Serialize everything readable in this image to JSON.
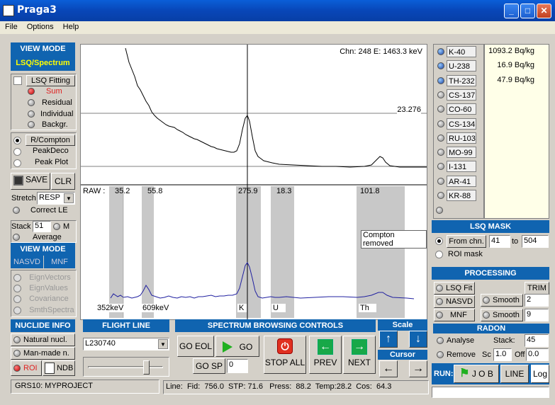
{
  "window": {
    "title": "Praga3"
  },
  "menu": [
    "File",
    "Options",
    "Help"
  ],
  "view_mode": {
    "header": "VIEW MODE",
    "mode": "LSQ/Spectrum",
    "lsq_fitting": "LSQ Fitting",
    "sum": "Sum",
    "residual": "Residual",
    "individual": "Individual",
    "backgr": "Backgr.",
    "r_compton": "R/Compton",
    "peakdeco": "PeakDeco",
    "peak_plot": "Peak Plot",
    "save": "SAVE",
    "clr": "CLR",
    "stretch_label": "Stretch",
    "stretch_value": "RESP",
    "correct_le": "Correct LE",
    "stack_label": "Stack",
    "stack_value": "51",
    "m_label": "M",
    "average": "Average"
  },
  "view_mode2": {
    "header": "VIEW MODE",
    "nasvd": "NASVD",
    "mnf": "MNF",
    "items": [
      "EignVectors",
      "EignValues",
      "Covariance",
      "SmthSpectra"
    ]
  },
  "nuclide_info": {
    "header": "NUCLIDE INFO",
    "natural": "Natural nucl.",
    "manmade": "Man-made n.",
    "roi": "ROI",
    "ndb": "NDB"
  },
  "status_left": "GRS10: MYPROJECT",
  "flight_line": {
    "header": "FLIGHT LINE",
    "value": "L230740"
  },
  "browse": {
    "header": "SPECTRUM BROWSING CONTROLS",
    "go_eol": "GO EOL",
    "go": "GO",
    "go_sp": "GO SP",
    "go_sp_value": "0",
    "stop_all": "STOP ALL",
    "prev": "PREV",
    "next": "NEXT"
  },
  "scale": {
    "header": "Scale",
    "cursor": "Cursor"
  },
  "line_status": "Line:  Fid:  756.0  STP: 71.6   Press:  88.2  Temp:28.2  Cos:  64.3",
  "spectrum": {
    "cursor_readout": "Chn: 248  E: 1463.3 keV",
    "level_label": "23.276",
    "raw_label": "RAW :",
    "roi_values": [
      "35.2",
      "55.8",
      "275.9",
      "18.3",
      "101.8"
    ],
    "compton_note": "Compton removed",
    "markers": [
      "352keV",
      "609keV",
      "K",
      "U",
      "Th"
    ]
  },
  "nuclides": [
    {
      "name": "K-40",
      "value": "1093.2 Bq/kg",
      "active": true
    },
    {
      "name": "U-238",
      "value": "16.9 Bq/kg",
      "active": true
    },
    {
      "name": "TH-232",
      "value": "47.9 Bq/kg",
      "active": true
    },
    {
      "name": "CS-137",
      "value": "",
      "active": false
    },
    {
      "name": "CO-60",
      "value": "",
      "active": false
    },
    {
      "name": "CS-134",
      "value": "",
      "active": false
    },
    {
      "name": "RU-103",
      "value": "",
      "active": false
    },
    {
      "name": "MO-99",
      "value": "",
      "active": false
    },
    {
      "name": "I-131",
      "value": "",
      "active": false
    },
    {
      "name": "AR-41",
      "value": "",
      "active": false
    },
    {
      "name": "KR-88",
      "value": "",
      "active": false
    }
  ],
  "lsq_mask": {
    "header": "LSQ MASK",
    "from_chn": "From chn.",
    "from_value": "41",
    "to": "to",
    "to_value": "504",
    "roi_mask": "ROI mask"
  },
  "processing": {
    "header": "PROCESSING",
    "lsq_fit": "LSQ Fit",
    "trim": "TRIM",
    "nasvd": "NASVD",
    "mnf": "MNF",
    "smooth1": "Smooth",
    "smooth1_value": "2",
    "smooth2": "Smooth",
    "smooth2_value": "9"
  },
  "radon": {
    "header": "RADON",
    "analyse": "Analyse",
    "stack_label": "Stack:",
    "stack_value": "45",
    "remove": "Remove",
    "sc_label": "Sc",
    "sc_value": "1.0",
    "off_label": "Off",
    "off_value": "0.0"
  },
  "run": {
    "label": "RUN:",
    "job": "J O B",
    "line": "LINE",
    "log": "Log"
  }
}
